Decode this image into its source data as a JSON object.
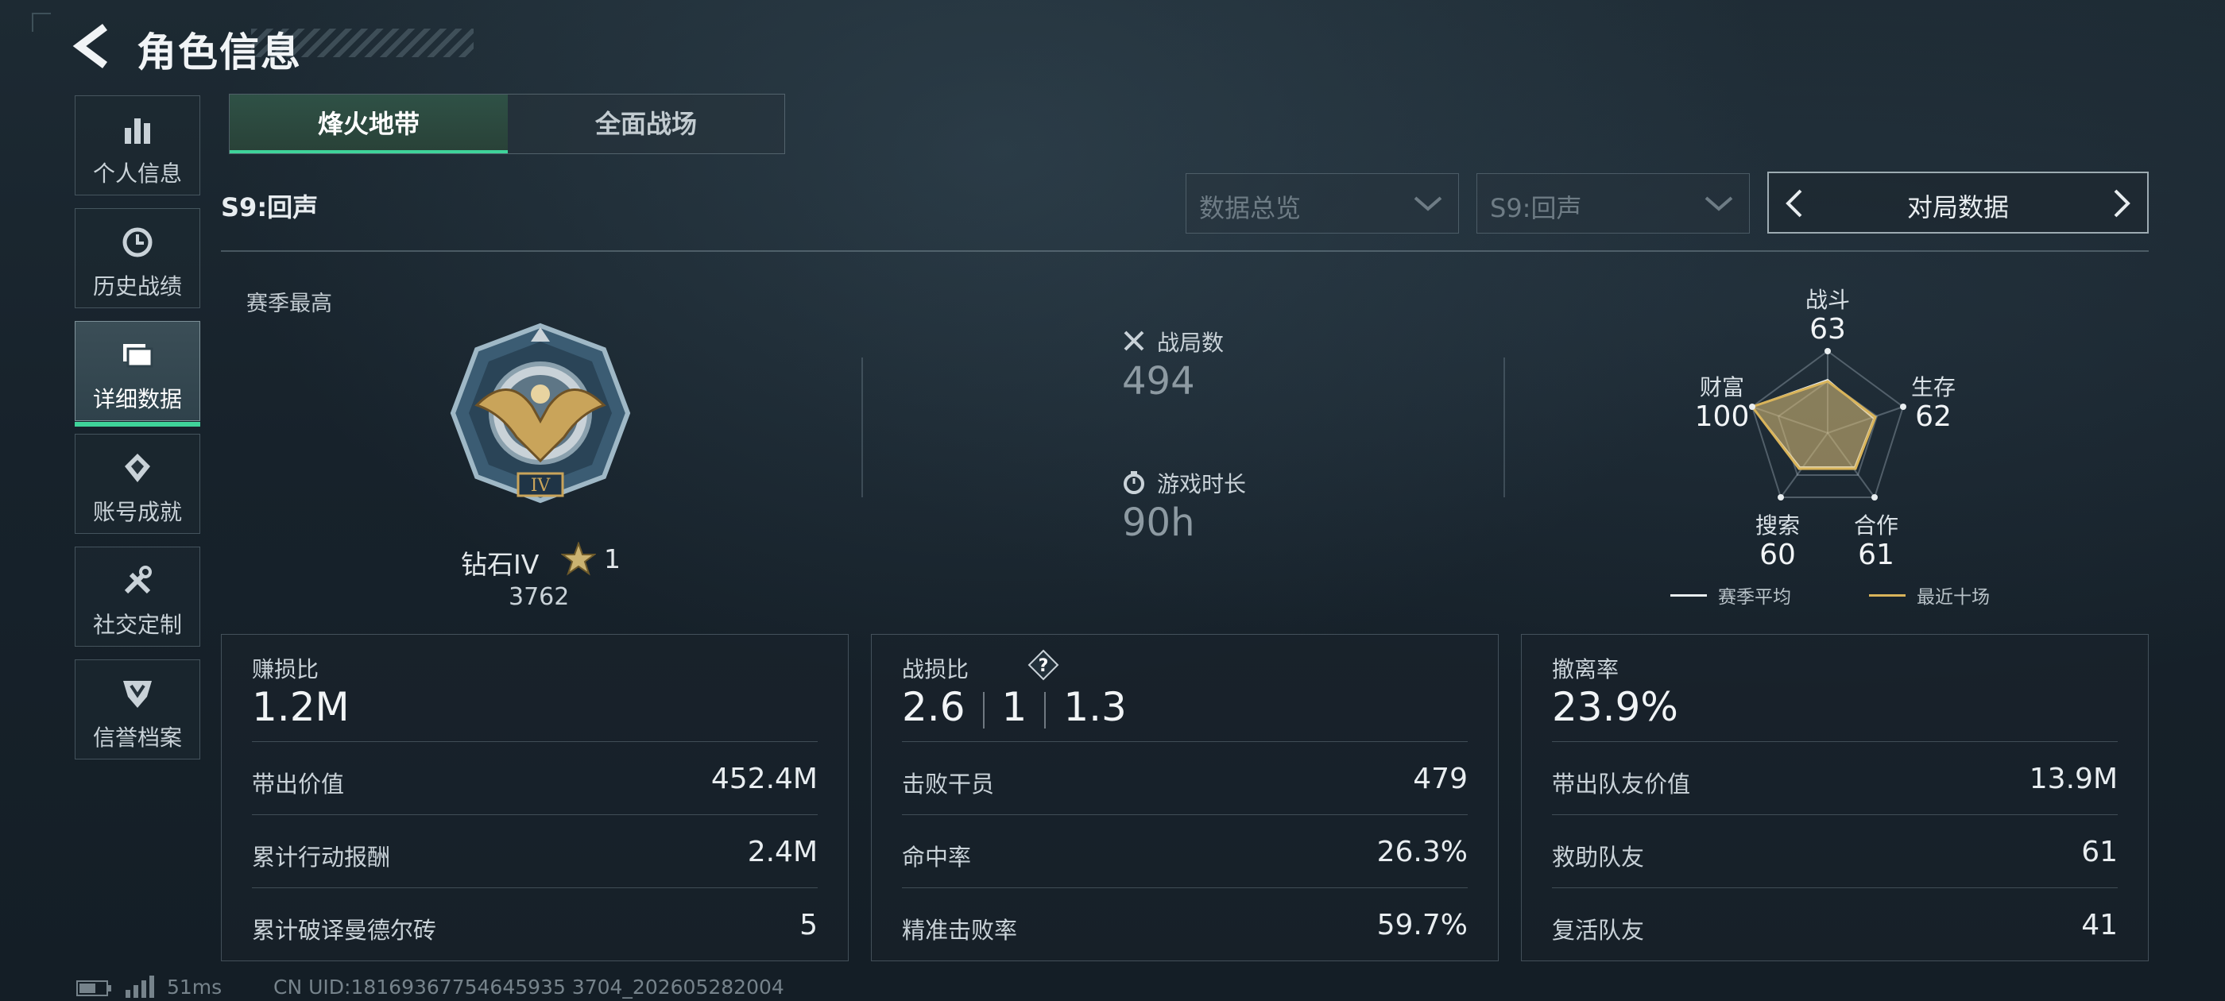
{
  "header": {
    "title": "角色信息"
  },
  "sidebar": {
    "items": [
      {
        "label": "个人信息",
        "icon": "bar-chart-icon"
      },
      {
        "label": "历史战绩",
        "icon": "history-clock-icon"
      },
      {
        "label": "详细数据",
        "icon": "folder-icon",
        "active": true
      },
      {
        "label": "账号成就",
        "icon": "achievement-icon"
      },
      {
        "label": "社交定制",
        "icon": "tools-icon"
      },
      {
        "label": "信誉档案",
        "icon": "shield-icon"
      }
    ]
  },
  "tabs": [
    {
      "label": "烽火地带",
      "active": true
    },
    {
      "label": "全面战场"
    }
  ],
  "season": {
    "label": "S9:回声"
  },
  "filters": {
    "data_scope": "数据总览",
    "season_select": "S9:回声",
    "switcher_label": "对局数据"
  },
  "rank": {
    "section_label": "赛季最高",
    "name": "钻石IV",
    "stars": "1",
    "score": "3762",
    "medal_numeral": "IV"
  },
  "summary": {
    "matches_label": "战局数",
    "matches_value": "494",
    "playtime_label": "游戏时长",
    "playtime_value": "90h"
  },
  "radar": {
    "axes": [
      {
        "label": "战斗",
        "value": "63"
      },
      {
        "label": "生存",
        "value": "62"
      },
      {
        "label": "合作",
        "value": "61"
      },
      {
        "label": "搜索",
        "value": "60"
      },
      {
        "label": "财富",
        "value": "100"
      }
    ],
    "legend": [
      {
        "label": "赛季平均",
        "color": "#e9eef0"
      },
      {
        "label": "最近十场",
        "color": "#d9b45a"
      }
    ]
  },
  "cards": {
    "profit": {
      "title": "赚损比",
      "big": "1.2M",
      "rows": [
        {
          "label": "带出价值",
          "value": "452.4M"
        },
        {
          "label": "累计行动报酬",
          "value": "2.4M"
        },
        {
          "label": "累计破译曼德尔砖",
          "value": "5"
        }
      ]
    },
    "combat": {
      "title": "战损比",
      "help": "?",
      "ratio": [
        "2.6",
        "1",
        "1.3"
      ],
      "rows": [
        {
          "label": "击败干员",
          "value": "479"
        },
        {
          "label": "命中率",
          "value": "26.3%"
        },
        {
          "label": "精准击败率",
          "value": "59.7%"
        }
      ]
    },
    "extract": {
      "title": "撤离率",
      "big": "23.9%",
      "rows": [
        {
          "label": "带出队友价值",
          "value": "13.9M"
        },
        {
          "label": "救助队友",
          "value": "61"
        },
        {
          "label": "复活队友",
          "value": "41"
        }
      ]
    }
  },
  "status_bar": {
    "ping": "51ms",
    "uid": "CN UID:18169367754645935 3704_202605282004"
  }
}
